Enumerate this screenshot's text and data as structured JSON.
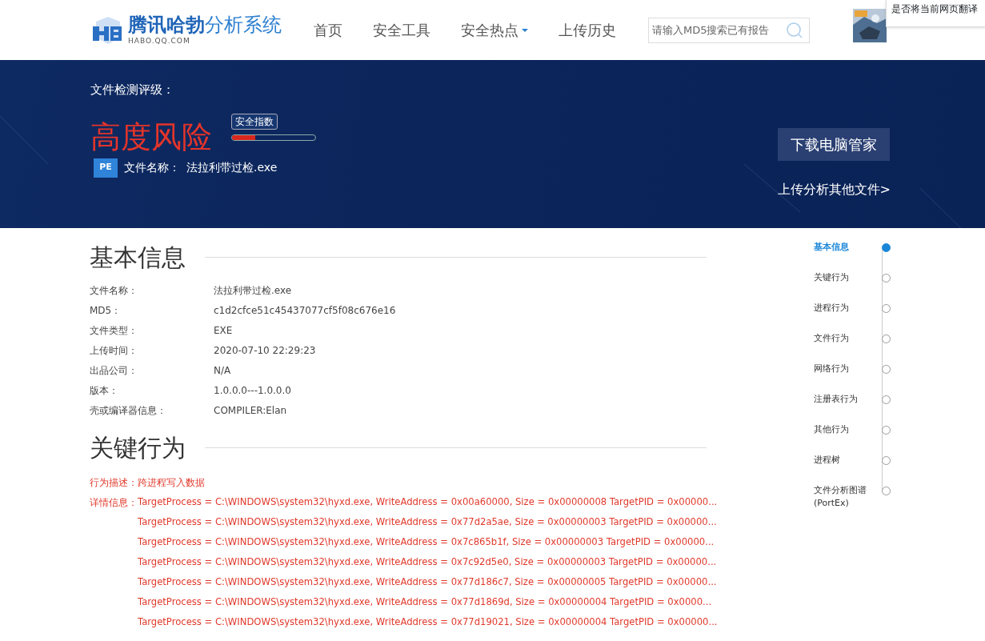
{
  "header": {
    "logo_title": "腾讯哈勃",
    "logo_subtitle": "分析系统",
    "logo_domain": "HABO.QQ.COM",
    "nav": [
      {
        "label": "首页",
        "dropdown": false
      },
      {
        "label": "安全工具",
        "dropdown": false
      },
      {
        "label": "安全热点",
        "dropdown": true
      },
      {
        "label": "上传历史",
        "dropdown": false
      }
    ],
    "search": {
      "placeholder": "请输入MD5搜索已有报告"
    },
    "translate_prompt": "是否将当前网页翻译"
  },
  "banner": {
    "rating_label": "文件检测评级：",
    "rating": "高度风险",
    "meter_label": "安全指数",
    "meter": {
      "level": 0.28
    },
    "file_icon": "PE",
    "file_label": "文件名称：",
    "file_name": "法拉利带过检.exe",
    "download_button": "下载电脑管家",
    "upload_link": "上传分析其他文件>"
  },
  "basic_info": {
    "title": "基本信息",
    "rows": [
      {
        "label": "文件名称：",
        "value": "法拉利带过检.exe"
      },
      {
        "label": "MD5：",
        "value": "c1d2cfce51c45437077cf5f08c676e16"
      },
      {
        "label": "文件类型：",
        "value": "EXE"
      },
      {
        "label": "上传时间：",
        "value": "2020-07-10 22:29:23"
      },
      {
        "label": "出品公司：",
        "value": "N/A"
      },
      {
        "label": "版本：",
        "value": "1.0.0.0---1.0.0.0"
      },
      {
        "label": "壳或编译器信息：",
        "value": "COMPILER:Elan"
      }
    ]
  },
  "key_behavior": {
    "title": "关键行为",
    "description_label": "行为描述：",
    "description": "跨进程写入数据",
    "details_label": "详情信息：",
    "details": [
      "TargetProcess = C:\\WINDOWS\\system32\\hyxd.exe, WriteAddress = 0x00a60000, Size = 0x00000008 TargetPID = 0x00000...",
      "TargetProcess = C:\\WINDOWS\\system32\\hyxd.exe, WriteAddress = 0x77d2a5ae, Size = 0x00000003 TargetPID = 0x00000...",
      "TargetProcess = C:\\WINDOWS\\system32\\hyxd.exe, WriteAddress = 0x7c865b1f, Size = 0x00000003 TargetPID = 0x00000...",
      "TargetProcess = C:\\WINDOWS\\system32\\hyxd.exe, WriteAddress = 0x7c92d5e0, Size = 0x00000003 TargetPID = 0x00000...",
      "TargetProcess = C:\\WINDOWS\\system32\\hyxd.exe, WriteAddress = 0x77d186c7, Size = 0x00000005 TargetPID = 0x00000...",
      "TargetProcess = C:\\WINDOWS\\system32\\hyxd.exe, WriteAddress = 0x77d1869d, Size = 0x00000004 TargetPID = 0x0000...",
      "TargetProcess = C:\\WINDOWS\\system32\\hyxd.exe, WriteAddress = 0x77d19021, Size = 0x00000004 TargetPID = 0x00000..."
    ]
  },
  "side_nav": [
    {
      "label": "基本信息",
      "selected": true
    },
    {
      "label": "关键行为",
      "selected": false
    },
    {
      "label": "进程行为",
      "selected": false
    },
    {
      "label": "文件行为",
      "selected": false
    },
    {
      "label": "网络行为",
      "selected": false
    },
    {
      "label": "注册表行为",
      "selected": false
    },
    {
      "label": "其他行为",
      "selected": false
    },
    {
      "label": "进程树",
      "selected": false
    },
    {
      "label": "文件分析图谱\n(PortEx)",
      "selected": false
    }
  ]
}
